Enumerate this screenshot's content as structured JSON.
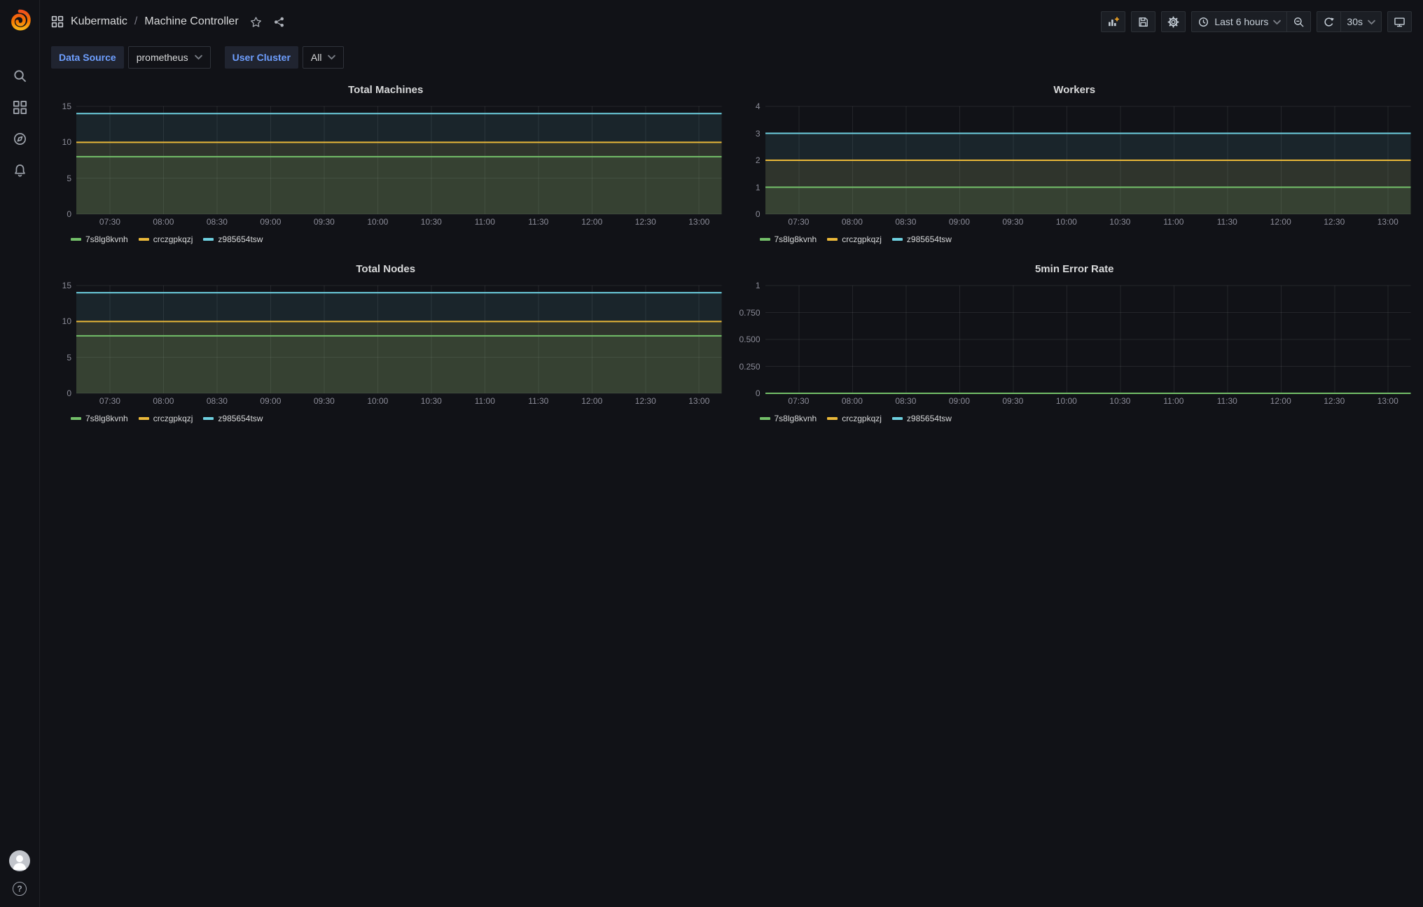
{
  "app": {
    "name": "Grafana"
  },
  "icons": {
    "logo": "grafana-logo",
    "sidebar": [
      "search-icon",
      "dashboards-icon",
      "explore-compass-icon",
      "alerting-bell-icon"
    ],
    "sidebar_bottom": [
      "user-avatar",
      "help-icon"
    ],
    "breadcrumb": [
      "dashboards-icon",
      "star-icon",
      "share-icon"
    ],
    "toolbar": [
      "add-panel-icon",
      "save-icon",
      "settings-gear-icon",
      "clock-icon",
      "chevron-down-icon",
      "zoom-out-icon",
      "refresh-icon",
      "monitor-icon"
    ]
  },
  "header": {
    "breadcrumb": {
      "section": "Kubermatic",
      "separator": "/",
      "title": "Machine Controller"
    },
    "toolbar": {
      "time_range": "Last 6 hours",
      "refresh_interval": "30s"
    }
  },
  "variables": [
    {
      "label": "Data Source",
      "value": "prometheus"
    },
    {
      "label": "User Cluster",
      "value": "All"
    }
  ],
  "colors": {
    "green": "#73BF69",
    "yellow": "#EAB839",
    "cyan": "#6ED0E0",
    "variable_label_blue": "#6e9fff",
    "background": "#111217"
  },
  "chart_data": [
    {
      "type": "line",
      "title": "Total Machines",
      "xlabel": "",
      "ylabel": "",
      "ylim": [
        0,
        15
      ],
      "grid": true,
      "legend_position": "bottom",
      "fill_opacity": 0.1,
      "x": [
        "07:30",
        "08:00",
        "08:30",
        "09:00",
        "09:30",
        "10:00",
        "10:30",
        "11:00",
        "11:30",
        "12:00",
        "12:30",
        "13:00"
      ],
      "y_ticks": [
        {
          "v": 0,
          "label": "0"
        },
        {
          "v": 5,
          "label": "5"
        },
        {
          "v": 10,
          "label": "10"
        },
        {
          "v": 15,
          "label": "15"
        }
      ],
      "series": [
        {
          "name": "7s8lg8kvnh",
          "color": "#73BF69",
          "values": [
            8,
            8,
            8,
            8,
            8,
            8,
            8,
            8,
            8,
            8,
            8,
            8
          ]
        },
        {
          "name": "crczgpkqzj",
          "color": "#EAB839",
          "values": [
            10,
            10,
            10,
            10,
            10,
            10,
            10,
            10,
            10,
            10,
            10,
            10
          ]
        },
        {
          "name": "z985654tsw",
          "color": "#6ED0E0",
          "values": [
            14,
            14,
            14,
            14,
            14,
            14,
            14,
            14,
            14,
            14,
            14,
            14
          ]
        }
      ]
    },
    {
      "type": "line",
      "title": "Workers",
      "xlabel": "",
      "ylabel": "",
      "ylim": [
        0,
        4
      ],
      "grid": true,
      "legend_position": "bottom",
      "fill_opacity": 0.1,
      "x": [
        "07:30",
        "08:00",
        "08:30",
        "09:00",
        "09:30",
        "10:00",
        "10:30",
        "11:00",
        "11:30",
        "12:00",
        "12:30",
        "13:00"
      ],
      "y_ticks": [
        {
          "v": 0,
          "label": "0"
        },
        {
          "v": 1,
          "label": "1"
        },
        {
          "v": 2,
          "label": "2"
        },
        {
          "v": 3,
          "label": "3"
        },
        {
          "v": 4,
          "label": "4"
        }
      ],
      "series": [
        {
          "name": "7s8lg8kvnh",
          "color": "#73BF69",
          "values": [
            1,
            1,
            1,
            1,
            1,
            1,
            1,
            1,
            1,
            1,
            1,
            1
          ]
        },
        {
          "name": "crczgpkqzj",
          "color": "#EAB839",
          "values": [
            2,
            2,
            2,
            2,
            2,
            2,
            2,
            2,
            2,
            2,
            2,
            2
          ]
        },
        {
          "name": "z985654tsw",
          "color": "#6ED0E0",
          "values": [
            3,
            3,
            3,
            3,
            3,
            3,
            3,
            3,
            3,
            3,
            3,
            3
          ]
        }
      ]
    },
    {
      "type": "line",
      "title": "Total Nodes",
      "xlabel": "",
      "ylabel": "",
      "ylim": [
        0,
        15
      ],
      "grid": true,
      "legend_position": "bottom",
      "fill_opacity": 0.1,
      "x": [
        "07:30",
        "08:00",
        "08:30",
        "09:00",
        "09:30",
        "10:00",
        "10:30",
        "11:00",
        "11:30",
        "12:00",
        "12:30",
        "13:00"
      ],
      "y_ticks": [
        {
          "v": 0,
          "label": "0"
        },
        {
          "v": 5,
          "label": "5"
        },
        {
          "v": 10,
          "label": "10"
        },
        {
          "v": 15,
          "label": "15"
        }
      ],
      "series": [
        {
          "name": "7s8lg8kvnh",
          "color": "#73BF69",
          "values": [
            8,
            8,
            8,
            8,
            8,
            8,
            8,
            8,
            8,
            8,
            8,
            8
          ]
        },
        {
          "name": "crczgpkqzj",
          "color": "#EAB839",
          "values": [
            10,
            10,
            10,
            10,
            10,
            10,
            10,
            10,
            10,
            10,
            10,
            10
          ]
        },
        {
          "name": "z985654tsw",
          "color": "#6ED0E0",
          "values": [
            14,
            14,
            14,
            14,
            14,
            14,
            14,
            14,
            14,
            14,
            14,
            14
          ]
        }
      ]
    },
    {
      "type": "line",
      "title": "5min Error Rate",
      "xlabel": "",
      "ylabel": "",
      "ylim": [
        0,
        1
      ],
      "grid": true,
      "legend_position": "bottom",
      "fill_opacity": 0.1,
      "x": [
        "07:30",
        "08:00",
        "08:30",
        "09:00",
        "09:30",
        "10:00",
        "10:30",
        "11:00",
        "11:30",
        "12:00",
        "12:30",
        "13:00"
      ],
      "y_ticks": [
        {
          "v": 0,
          "label": "0"
        },
        {
          "v": 0.25,
          "label": "0.250"
        },
        {
          "v": 0.5,
          "label": "0.500"
        },
        {
          "v": 0.75,
          "label": "0.750"
        },
        {
          "v": 1,
          "label": "1"
        }
      ],
      "series": [
        {
          "name": "7s8lg8kvnh",
          "color": "#73BF69",
          "values": [
            0,
            0,
            0,
            0,
            0,
            0,
            0,
            0,
            0,
            0,
            0,
            0
          ]
        },
        {
          "name": "crczgpkqzj",
          "color": "#EAB839",
          "values": [
            0,
            0,
            0,
            0,
            0,
            0,
            0,
            0,
            0,
            0,
            0,
            0
          ]
        },
        {
          "name": "z985654tsw",
          "color": "#6ED0E0",
          "values": [
            0,
            0,
            0,
            0,
            0,
            0,
            0,
            0,
            0,
            0,
            0,
            0
          ]
        }
      ]
    }
  ]
}
